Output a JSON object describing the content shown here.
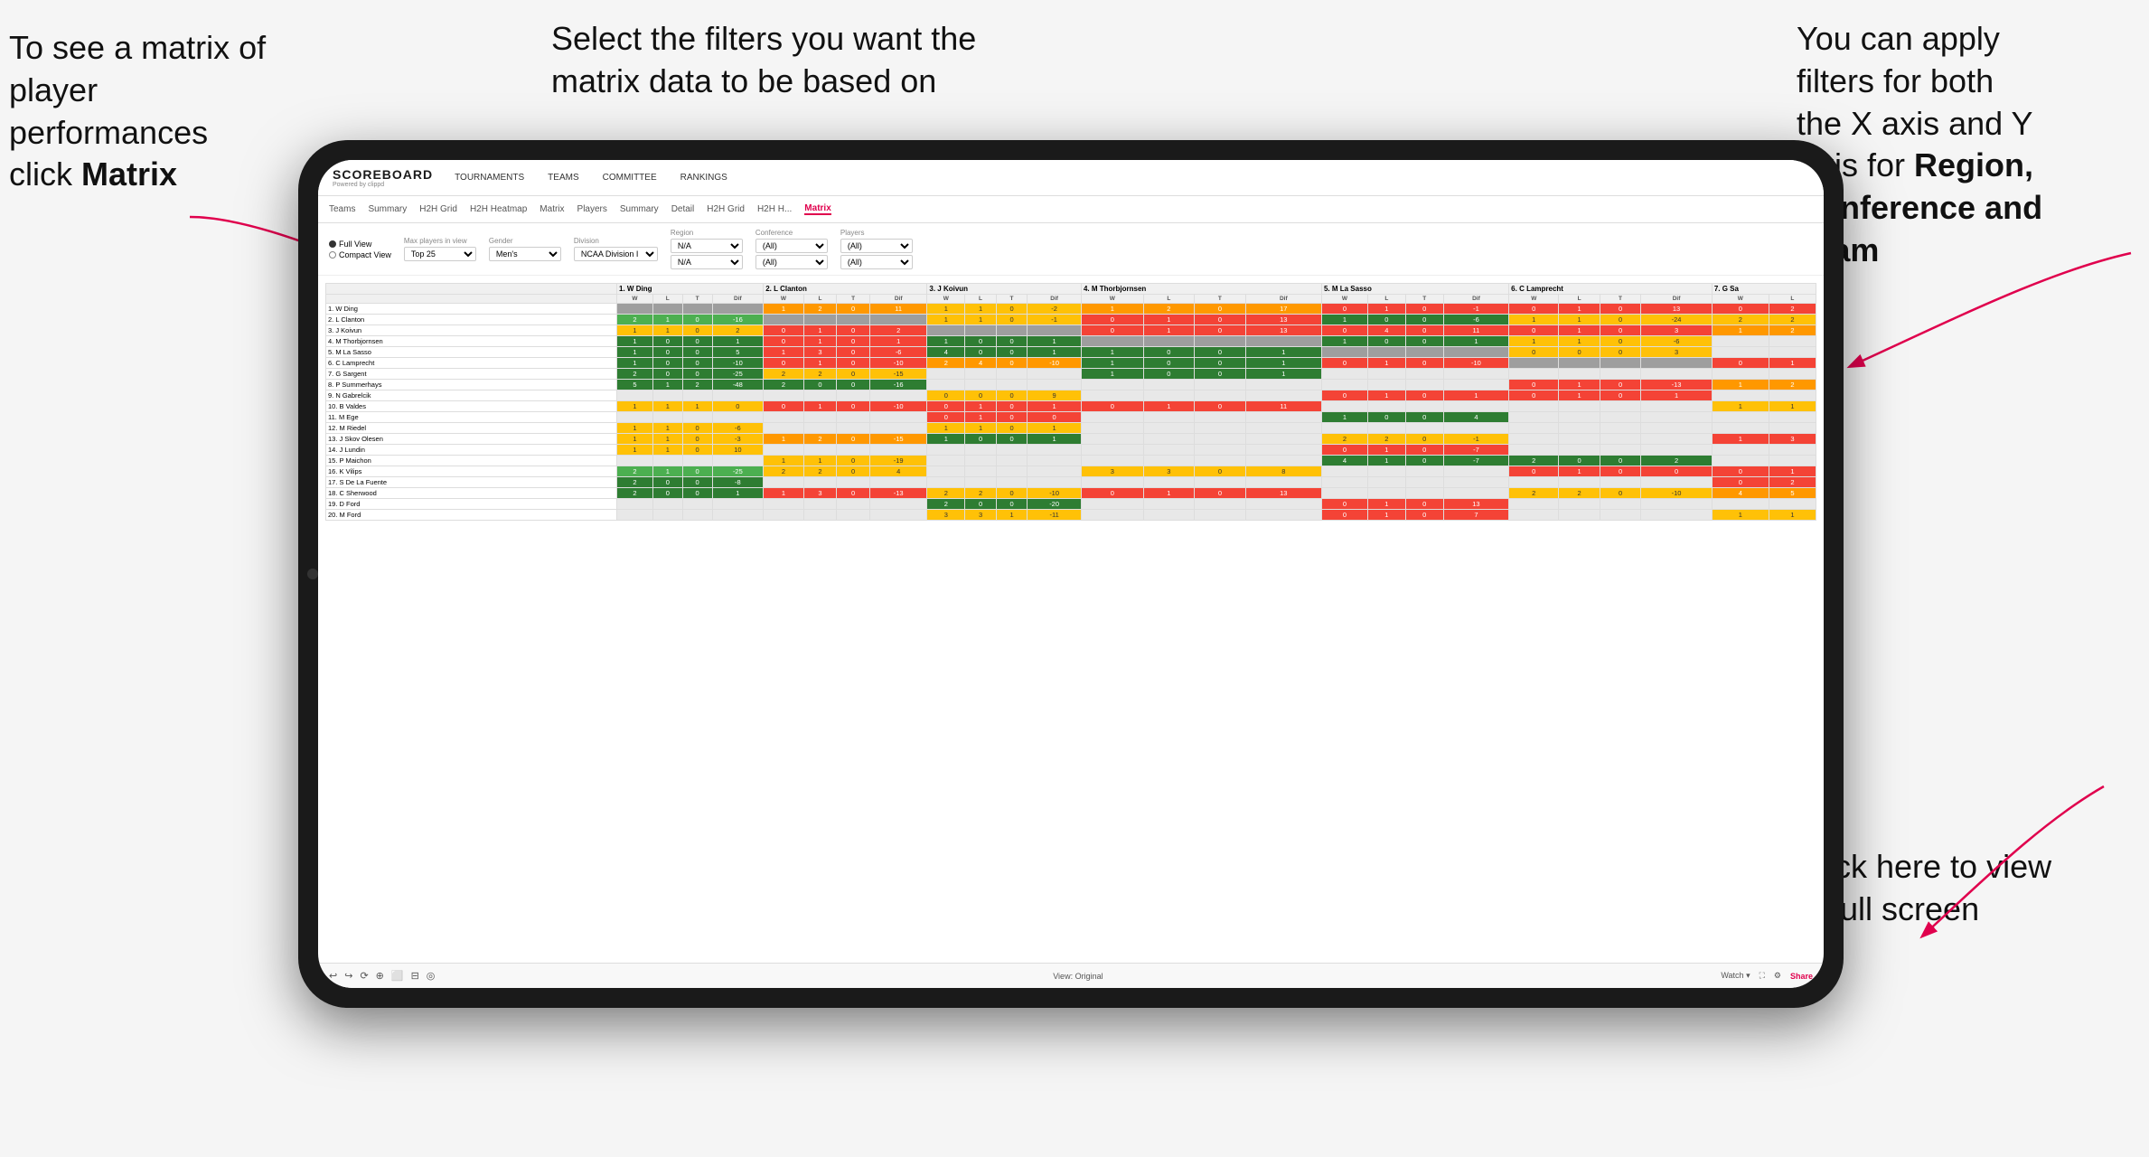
{
  "annotations": {
    "left": {
      "line1": "To see a matrix of",
      "line2": "player performances",
      "line3_pre": "click ",
      "line3_bold": "Matrix"
    },
    "center": {
      "text": "Select the filters you want the matrix data to be based on"
    },
    "right": {
      "line1": "You  can apply",
      "line2": "filters for both",
      "line3": "the X axis and Y",
      "line4_pre": "Axis for ",
      "line4_bold": "Region,",
      "line5_bold": "Conference and",
      "line6_bold": "Team"
    },
    "bottom_right": {
      "line1": "Click here to view",
      "line2": "in full screen"
    }
  },
  "app": {
    "logo": "SCOREBOARD",
    "logo_sub": "Powered by clippd",
    "nav": [
      "TOURNAMENTS",
      "TEAMS",
      "COMMITTEE",
      "RANKINGS"
    ],
    "sub_nav": [
      "Teams",
      "Summary",
      "H2H Grid",
      "H2H Heatmap",
      "Matrix",
      "Players",
      "Summary",
      "Detail",
      "H2H Grid",
      "H2H H...",
      "Matrix"
    ],
    "active_tab": "Matrix",
    "filters": {
      "view_options": [
        "Full View",
        "Compact View"
      ],
      "selected_view": "Full View",
      "max_players_label": "Max players in view",
      "max_players_value": "Top 25",
      "gender_label": "Gender",
      "gender_value": "Men's",
      "division_label": "Division",
      "division_value": "NCAA Division I",
      "region_label": "Region",
      "region_value1": "N/A",
      "region_value2": "N/A",
      "conference_label": "Conference",
      "conference_value1": "(All)",
      "conference_value2": "(All)",
      "players_label": "Players",
      "players_value1": "(All)",
      "players_value2": "(All)"
    },
    "col_headers": [
      "1. W Ding",
      "2. L Clanton",
      "3. J Koivun",
      "4. M Thorbjornsen",
      "5. M La Sasso",
      "6. C Lamprecht",
      "7. G Sa"
    ],
    "sub_col_headers": [
      "W",
      "L",
      "T",
      "Dif"
    ],
    "rows": [
      {
        "name": "1. W Ding",
        "data": [
          [
            null,
            null
          ],
          [
            1,
            2,
            0,
            11
          ],
          [
            1,
            1,
            0,
            -2
          ],
          [
            1,
            2,
            0,
            17
          ],
          [
            0,
            1,
            0,
            -1
          ],
          [
            0,
            1,
            0,
            13
          ],
          [
            0,
            2
          ]
        ]
      },
      {
        "name": "2. L Clanton",
        "data": [
          [
            2,
            1,
            0,
            -16
          ],
          [
            null,
            null
          ],
          [
            1,
            1,
            0,
            -1
          ],
          [
            0,
            1,
            0,
            13
          ],
          [
            1,
            0,
            0,
            -6
          ],
          [
            1,
            1,
            0,
            -24
          ],
          [
            2,
            2
          ]
        ]
      },
      {
        "name": "3. J Koivun",
        "data": [
          [
            1,
            1,
            0,
            2
          ],
          [
            0,
            1,
            0,
            2
          ],
          [
            null,
            null
          ],
          [
            0,
            1,
            0,
            13
          ],
          [
            0,
            4,
            0,
            11
          ],
          [
            0,
            1,
            0,
            3
          ],
          [
            1,
            2
          ]
        ]
      },
      {
        "name": "4. M Thorbjornsen",
        "data": [
          [
            1,
            0,
            0,
            1
          ],
          [
            0,
            1,
            0,
            1
          ],
          [
            1,
            0,
            0,
            1
          ],
          [
            null,
            null
          ],
          [
            1,
            0,
            0,
            1
          ],
          [
            1,
            1,
            0,
            -6
          ],
          [
            null
          ]
        ]
      },
      {
        "name": "5. M La Sasso",
        "data": [
          [
            1,
            0,
            0,
            5
          ],
          [
            1,
            3,
            0,
            -6
          ],
          [
            4,
            0,
            0,
            1
          ],
          [
            1,
            0,
            0,
            1
          ],
          [
            null,
            null
          ],
          [
            0,
            0,
            0,
            3
          ],
          [
            null
          ]
        ]
      },
      {
        "name": "6. C Lamprecht",
        "data": [
          [
            1,
            0,
            0,
            -10
          ],
          [
            0,
            1,
            0,
            -10
          ],
          [
            2,
            4,
            0,
            -10
          ],
          [
            1,
            0,
            0,
            1
          ],
          [
            0,
            1,
            0,
            -10
          ],
          [
            null,
            null
          ],
          [
            0,
            1
          ]
        ]
      },
      {
        "name": "7. G Sargent",
        "data": [
          [
            2,
            0,
            0,
            -25
          ],
          [
            2,
            2,
            0,
            -15
          ],
          [
            null
          ],
          [
            1,
            0,
            0,
            1
          ],
          [
            null
          ],
          [
            null
          ],
          [
            null
          ]
        ]
      },
      {
        "name": "8. P Summerhays",
        "data": [
          [
            5,
            1,
            2,
            -48
          ],
          [
            2,
            0,
            0,
            -16
          ],
          [
            null
          ],
          [
            null
          ],
          [
            null
          ],
          [
            0,
            1,
            0,
            -13
          ],
          [
            1,
            2
          ]
        ]
      },
      {
        "name": "9. N Gabrelcik",
        "data": [
          [
            null
          ],
          [
            null
          ],
          [
            0,
            0,
            0,
            9
          ],
          [
            null
          ],
          [
            0,
            1,
            0,
            1
          ],
          [
            0,
            1,
            0,
            1
          ],
          [
            null
          ]
        ]
      },
      {
        "name": "10. B Valdes",
        "data": [
          [
            1,
            1,
            1,
            0
          ],
          [
            0,
            1,
            0,
            -10
          ],
          [
            0,
            1,
            0,
            1
          ],
          [
            0,
            1,
            0,
            11
          ],
          [
            null
          ],
          [
            null
          ],
          [
            1,
            1
          ]
        ]
      },
      {
        "name": "11. M Ege",
        "data": [
          [
            null
          ],
          [
            null
          ],
          [
            0,
            1,
            0,
            0
          ],
          [
            null
          ],
          [
            1,
            0,
            0,
            4
          ],
          [
            null
          ],
          [
            null
          ]
        ]
      },
      {
        "name": "12. M Riedel",
        "data": [
          [
            1,
            1,
            0,
            -6
          ],
          [
            null
          ],
          [
            1,
            1,
            0,
            1
          ],
          [
            null
          ],
          [
            null
          ],
          [
            null
          ],
          [
            null
          ]
        ]
      },
      {
        "name": "13. J Skov Olesen",
        "data": [
          [
            1,
            1,
            0,
            -3
          ],
          [
            1,
            2,
            0,
            -15
          ],
          [
            1,
            0,
            0,
            1
          ],
          [
            null
          ],
          [
            2,
            2,
            0,
            -1
          ],
          [
            null
          ],
          [
            1,
            3
          ]
        ]
      },
      {
        "name": "14. J Lundin",
        "data": [
          [
            1,
            1,
            0,
            10
          ],
          [
            null
          ],
          [
            null
          ],
          [
            null
          ],
          [
            0,
            1,
            0,
            -7
          ],
          [
            null
          ],
          [
            null
          ]
        ]
      },
      {
        "name": "15. P Maichon",
        "data": [
          [
            null
          ],
          [
            1,
            1,
            0,
            -19
          ],
          [
            null
          ],
          [
            null
          ],
          [
            4,
            1,
            0,
            -7
          ],
          [
            2,
            0,
            0,
            2
          ],
          [
            null
          ]
        ]
      },
      {
        "name": "16. K Vilips",
        "data": [
          [
            2,
            1,
            0,
            -25
          ],
          [
            2,
            2,
            0,
            4
          ],
          [
            null
          ],
          [
            3,
            3,
            0,
            8
          ],
          [
            null
          ],
          [
            0,
            1,
            0,
            0
          ],
          [
            0,
            1
          ]
        ]
      },
      {
        "name": "17. S De La Fuente",
        "data": [
          [
            2,
            0,
            0,
            -8
          ],
          [
            null
          ],
          [
            null
          ],
          [
            null
          ],
          [
            null
          ],
          [
            null
          ],
          [
            0,
            2
          ]
        ]
      },
      {
        "name": "18. C Sherwood",
        "data": [
          [
            2,
            0,
            0,
            1
          ],
          [
            1,
            3,
            0,
            -13
          ],
          [
            2,
            2,
            0,
            -10
          ],
          [
            0,
            1,
            0,
            13
          ],
          [
            null
          ],
          [
            2,
            2,
            0,
            -10
          ],
          [
            4,
            5
          ]
        ]
      },
      {
        "name": "19. D Ford",
        "data": [
          [
            null
          ],
          [
            null
          ],
          [
            2,
            0,
            0,
            -20
          ],
          [
            null
          ],
          [
            0,
            1,
            0,
            13
          ],
          [
            null
          ],
          [
            null
          ]
        ]
      },
      {
        "name": "20. M Ford",
        "data": [
          [
            null
          ],
          [
            null
          ],
          [
            3,
            3,
            1,
            -11
          ],
          [
            null
          ],
          [
            0,
            1,
            0,
            7
          ],
          [
            null
          ],
          [
            1,
            1
          ]
        ]
      }
    ],
    "toolbar": {
      "icons": [
        "↩",
        "↪",
        "⟳",
        "⊕",
        "⬜",
        "⊟",
        "◎"
      ],
      "view_label": "View: Original",
      "watch_label": "Watch ▾",
      "share_label": "Share"
    }
  }
}
